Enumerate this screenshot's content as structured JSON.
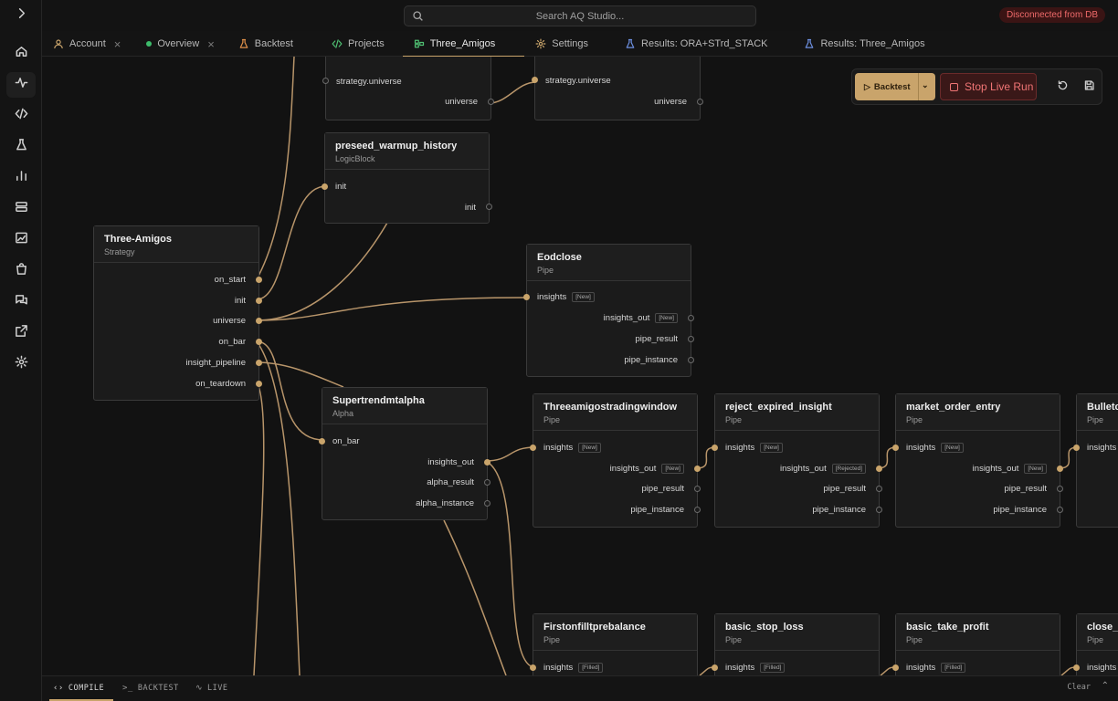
{
  "search": {
    "placeholder": "Search AQ Studio..."
  },
  "status": {
    "label": "Disconnected from DB"
  },
  "tabs": [
    {
      "label": "Account",
      "icon": "user-icon",
      "closable": true
    },
    {
      "label": "Overview",
      "icon": "status-dot",
      "closable": true
    },
    {
      "label": "Backtest",
      "icon": "flask-icon",
      "closable": false
    },
    {
      "label": "Projects",
      "icon": "code-icon",
      "closable": false
    },
    {
      "label": "Three_Amigos",
      "icon": "strategy-icon",
      "closable": false,
      "active": true
    },
    {
      "label": "Settings",
      "icon": "gear-icon",
      "closable": false
    },
    {
      "label": "Results: ORA+STrd_STACK",
      "icon": "beaker-icon",
      "closable": false
    },
    {
      "label": "Results: Three_Amigos",
      "icon": "beaker-icon",
      "closable": false
    }
  ],
  "toolbar": {
    "backtest_label": "Backtest",
    "stop_label": "Stop Live Run"
  },
  "nodes": {
    "top_left": {
      "in_port": "strategy.universe",
      "out_port": "universe"
    },
    "top_right": {
      "in_port": "strategy.universe",
      "out_port": "universe"
    },
    "preseed": {
      "title": "preseed_warmup_history",
      "subtitle": "LogicBlock",
      "in_port": "init",
      "out_port": "init"
    },
    "three_amigos": {
      "title": "Three-Amigos",
      "subtitle": "Strategy",
      "outputs": [
        "on_start",
        "init",
        "universe",
        "on_bar",
        "insight_pipeline",
        "on_teardown"
      ]
    },
    "eodclose": {
      "title": "Eodclose",
      "subtitle": "Pipe",
      "in_port": "insights",
      "in_tag": "[New]",
      "out_ports": [
        "insights_out",
        "pipe_result",
        "pipe_instance"
      ],
      "out_tag": "[New]"
    },
    "supertrend": {
      "title": "Supertrendmtalpha",
      "subtitle": "Alpha",
      "in_port": "on_bar",
      "out_ports": [
        "insights_out",
        "alpha_result",
        "alpha_instance"
      ]
    },
    "tatw": {
      "title": "Threeamigostradingwindow",
      "subtitle": "Pipe",
      "in_port": "insights",
      "in_tag": "[New]",
      "out_ports": [
        "insights_out",
        "pipe_result",
        "pipe_instance"
      ],
      "out_tag": "[New]"
    },
    "reject": {
      "title": "reject_expired_insight",
      "subtitle": "Pipe",
      "in_port": "insights",
      "in_tag": "[New]",
      "out_ports": [
        "insights_out",
        "pipe_result",
        "pipe_instance"
      ],
      "out_tag": "[Rejected]"
    },
    "market": {
      "title": "market_order_entry",
      "subtitle": "Pipe",
      "in_port": "insights",
      "in_tag": "[New]",
      "out_ports": [
        "insights_out",
        "pipe_result",
        "pipe_instance"
      ],
      "out_tag": "[New]"
    },
    "bulletc": {
      "title": "Bulletc",
      "subtitle": "Pipe",
      "in_port": "insights"
    },
    "firston": {
      "title": "Firstonfilltprebalance",
      "subtitle": "Pipe",
      "in_port": "insights",
      "in_tag": "[Filled]"
    },
    "stoploss": {
      "title": "basic_stop_loss",
      "subtitle": "Pipe",
      "in_port": "insights",
      "in_tag": "[Filled]"
    },
    "takeprofit": {
      "title": "basic_take_profit",
      "subtitle": "Pipe",
      "in_port": "insights",
      "in_tag": "[Filled]"
    },
    "close_r": {
      "title": "close_r",
      "subtitle": "Pipe",
      "in_port": "insights"
    }
  },
  "bottom": {
    "tabs": [
      "COMPILE",
      "BACKTEST",
      "LIVE"
    ],
    "clear_label": "Clear"
  },
  "colors": {
    "accent": "#c9a46b",
    "danger": "#f07575",
    "background": "#121212"
  }
}
